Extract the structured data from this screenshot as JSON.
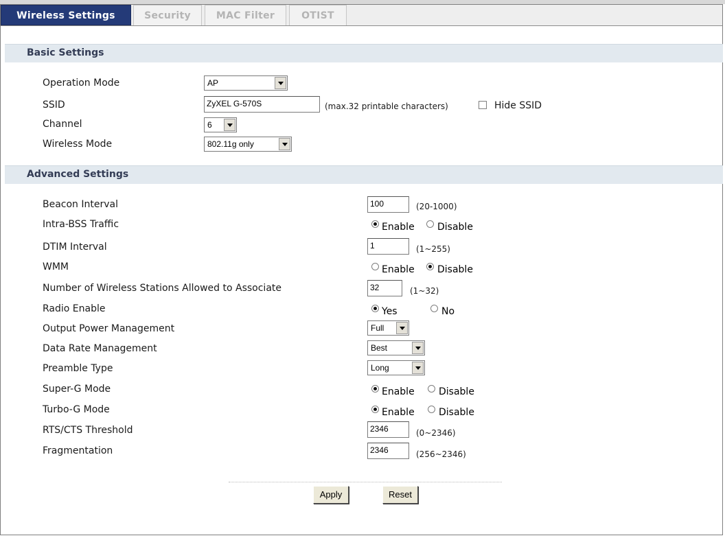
{
  "tabs": [
    {
      "label": "Wireless Settings",
      "active": true
    },
    {
      "label": "Security",
      "active": false
    },
    {
      "label": "MAC Filter",
      "active": false
    },
    {
      "label": "OTIST",
      "active": false
    }
  ],
  "basic": {
    "title": "Basic Settings",
    "operation_mode": {
      "label": "Operation Mode",
      "value": "AP"
    },
    "ssid": {
      "label": "SSID",
      "value": "ZyXEL G-570S",
      "hint": "(max.32 printable characters)",
      "hide_label": "Hide SSID",
      "hide_checked": false
    },
    "channel": {
      "label": "Channel",
      "value": "6"
    },
    "wireless_mode": {
      "label": "Wireless Mode",
      "value": "802.11g only"
    }
  },
  "advanced": {
    "title": "Advanced Settings",
    "beacon": {
      "label": "Beacon Interval",
      "value": "100",
      "hint": "(20-1000)"
    },
    "intra_bss": {
      "label": "Intra-BSS Traffic",
      "opt1": "Enable",
      "opt2": "Disable",
      "selected": "Enable"
    },
    "dtim": {
      "label": "DTIM Interval",
      "value": "1",
      "hint": "(1~255)"
    },
    "wmm": {
      "label": "WMM",
      "opt1": "Enable",
      "opt2": "Disable",
      "selected": "Disable"
    },
    "stations": {
      "label": "Number of Wireless Stations Allowed to Associate",
      "value": "32",
      "hint": "(1~32)"
    },
    "radio": {
      "label": "Radio Enable",
      "opt1": "Yes",
      "opt2": "No",
      "selected": "Yes"
    },
    "power": {
      "label": "Output Power Management",
      "value": "Full"
    },
    "rate": {
      "label": "Data Rate Management",
      "value": "Best"
    },
    "preamble": {
      "label": "Preamble Type",
      "value": "Long"
    },
    "superg": {
      "label": "Super-G Mode",
      "opt1": "Enable",
      "opt2": "Disable",
      "selected": "Enable"
    },
    "turbog": {
      "label": "Turbo-G Mode",
      "opt1": "Enable",
      "opt2": "Disable",
      "selected": "Enable"
    },
    "rts": {
      "label": "RTS/CTS Threshold",
      "value": "2346",
      "hint": "(0~2346)"
    },
    "frag": {
      "label": "Fragmentation",
      "value": "2346",
      "hint": "(256~2346)"
    }
  },
  "buttons": {
    "apply": "Apply",
    "reset": "Reset"
  }
}
